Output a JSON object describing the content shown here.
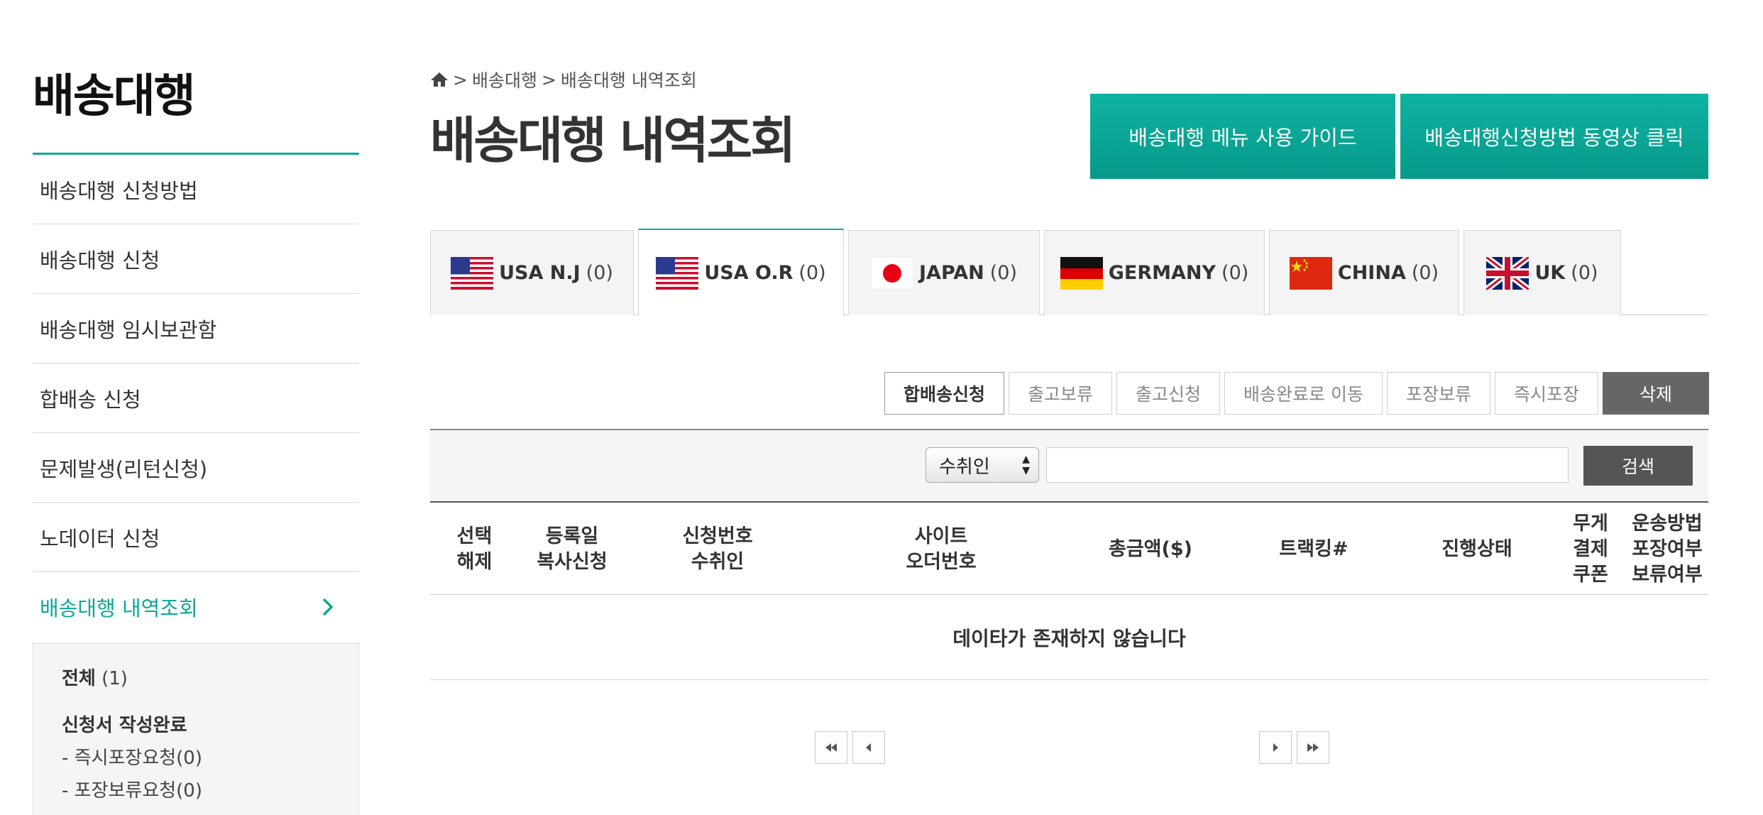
{
  "sidebar": {
    "title": "배송대행",
    "items": [
      {
        "label": "배송대행 신청방법"
      },
      {
        "label": "배송대행 신청"
      },
      {
        "label": "배송대행 임시보관함"
      },
      {
        "label": "합배송 신청"
      },
      {
        "label": "문제발생(리턴신청)"
      },
      {
        "label": "노데이터 신청"
      },
      {
        "label": "배송대행 내역조회",
        "active": true
      }
    ],
    "submenu": {
      "all_label": "전체",
      "all_count": "(1)",
      "group_label": "신청서 작성완료",
      "items": [
        {
          "label": "- 즉시포장요청(0)"
        },
        {
          "label": "- 포장보류요청(0)"
        }
      ]
    }
  },
  "breadcrumb": {
    "items": [
      "배송대행",
      "배송대행 내역조회"
    ],
    "separator": ">"
  },
  "page_title": "배송대행 내역조회",
  "guide_buttons": {
    "menu_guide": "배송대행 메뉴 사용 가이드",
    "video_guide": "배송대행신청방법 동영상 클릭"
  },
  "tabs": [
    {
      "name": "USA N.J",
      "count": "(0)",
      "flag": "usa-flag"
    },
    {
      "name": "USA O.R",
      "count": "(0)",
      "flag": "usa-flag",
      "active": true
    },
    {
      "name": "JAPAN",
      "count": "(0)",
      "flag": "japan-flag"
    },
    {
      "name": "GERMANY",
      "count": "(0)",
      "flag": "germany-flag"
    },
    {
      "name": "CHINA",
      "count": "(0)",
      "flag": "china-flag"
    },
    {
      "name": "UK",
      "count": "(0)",
      "flag": "uk-flag"
    }
  ],
  "actions": {
    "combine": "합배송신청",
    "hold_release": "출고보류",
    "release_request": "출고신청",
    "move_delivered": "배송완료로 이동",
    "hold_packing": "포장보류",
    "instant_packing": "즉시포장",
    "delete": "삭제"
  },
  "search": {
    "field_selected": "수취인",
    "input_value": "",
    "button": "검색"
  },
  "table": {
    "headers": [
      "선택\n해제",
      "등록일\n복사신청",
      "신청번호\n수취인",
      "사이트\n오더번호",
      "총금액($)",
      "트랙킹#",
      "진행상태",
      "무게\n결제\n쿠폰",
      "운송방법\n포장여부\n보류여부"
    ],
    "empty_message": "데이타가 존재하지 않습니다"
  },
  "colors": {
    "accent": "#0aa896",
    "dark_button": "#555555"
  }
}
